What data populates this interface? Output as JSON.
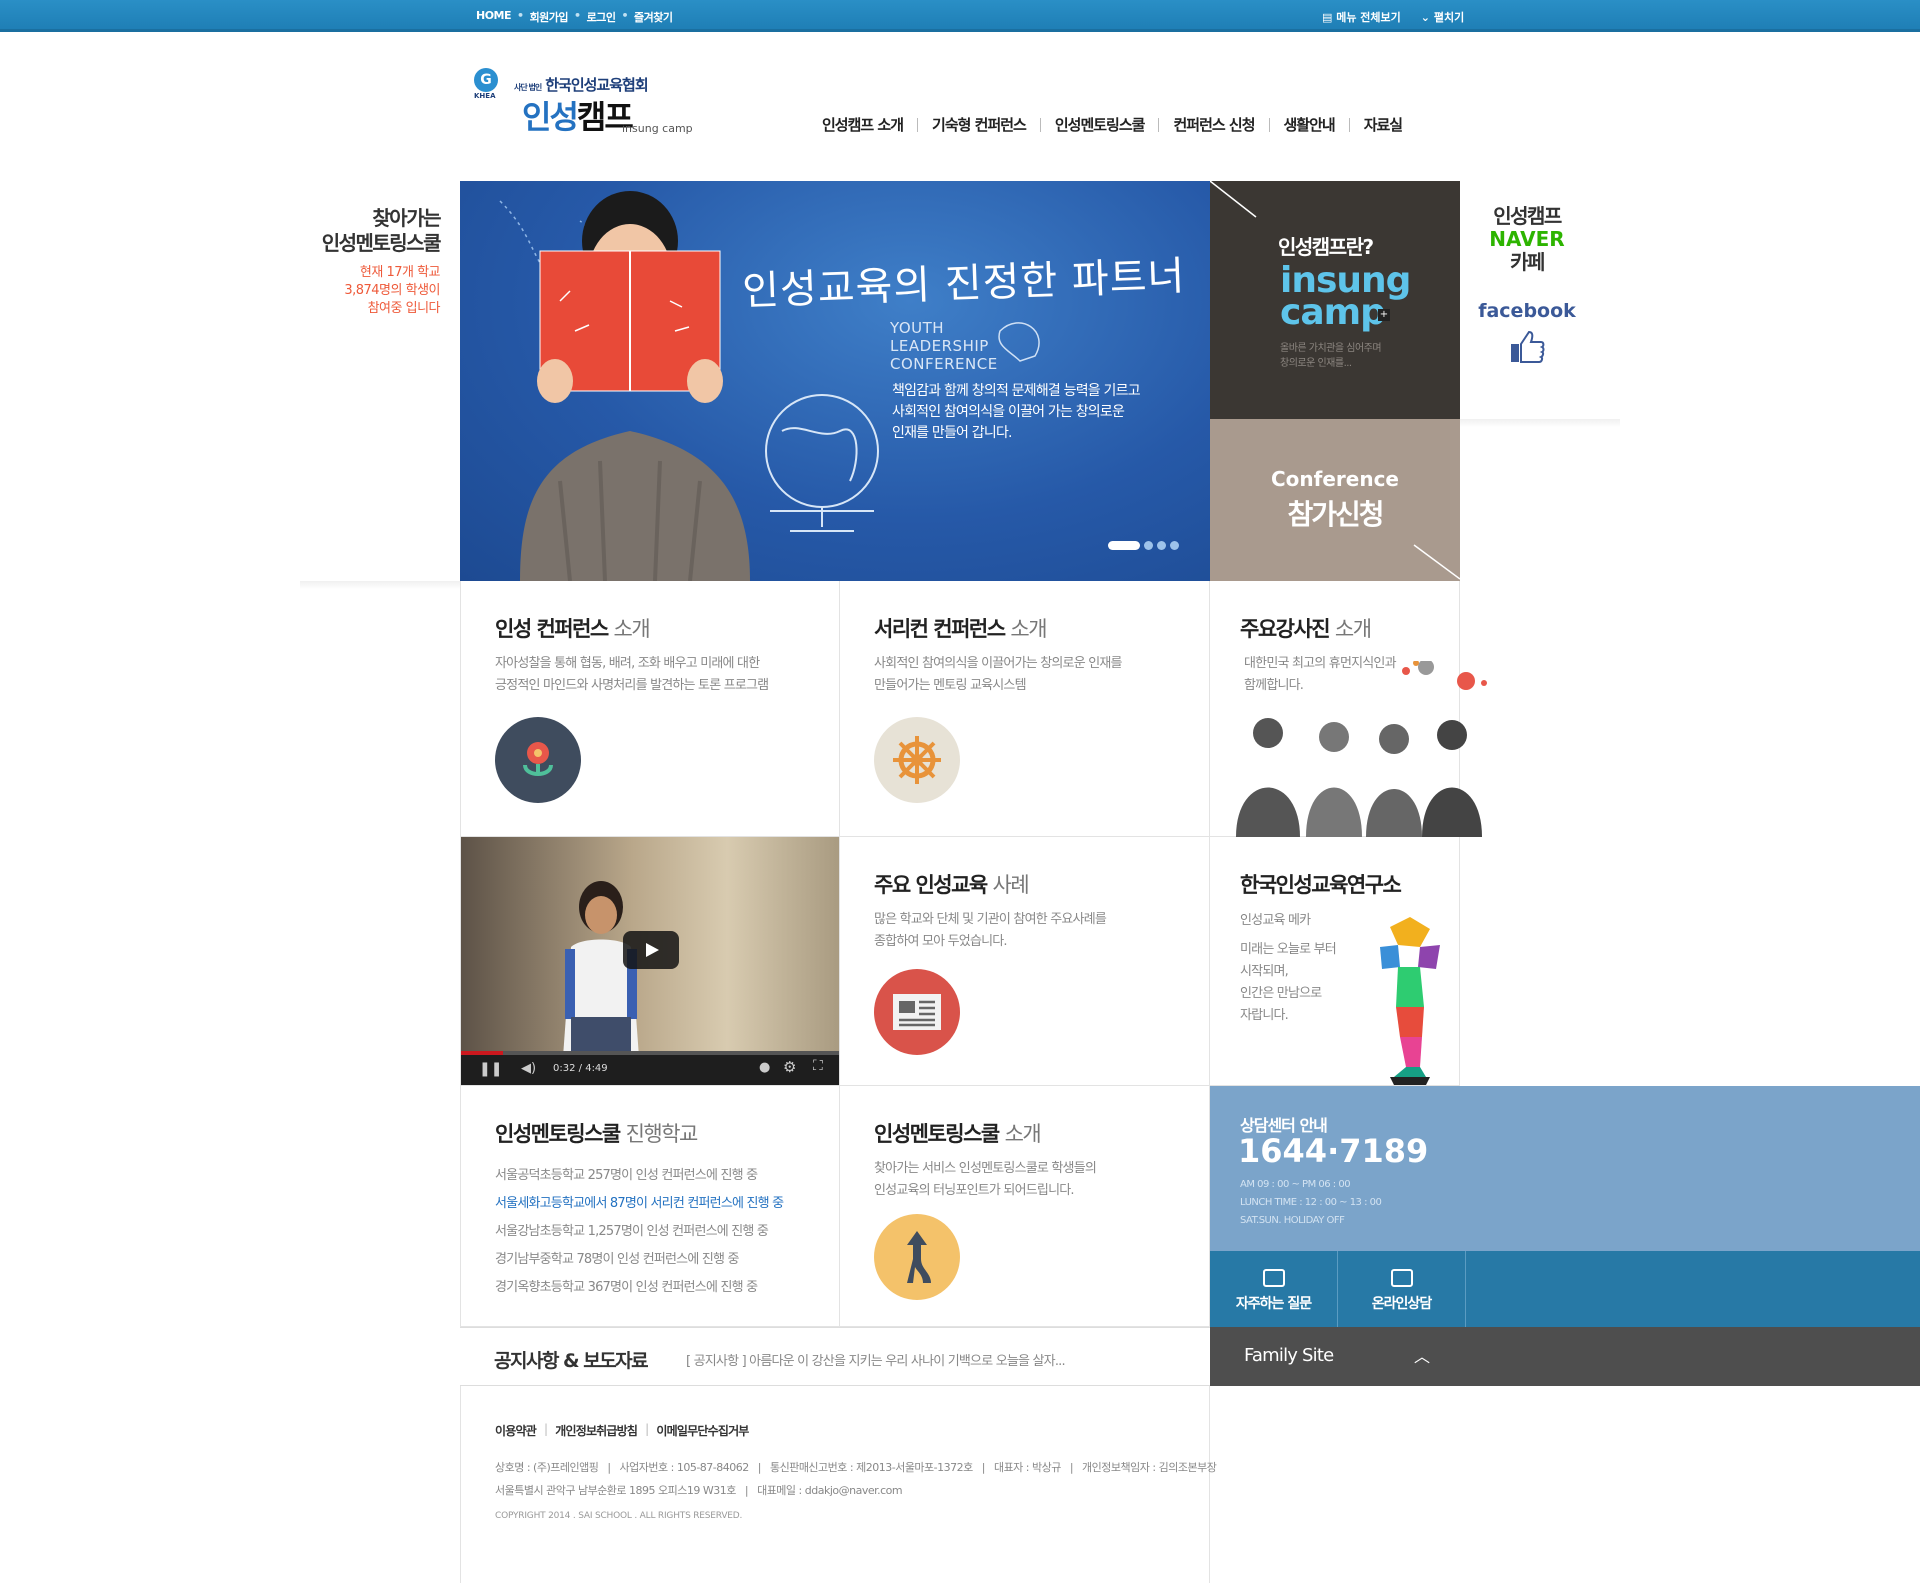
{
  "topbar": {
    "home": "HOME",
    "join": "회원가입",
    "login": "로그인",
    "bookmark": "즐겨찾기",
    "menu_all": "메뉴 전체보기",
    "expand": "펼치기"
  },
  "logo": {
    "badge": "G",
    "badge_text": "KHEA",
    "org_prefix": "사단 법인",
    "org": "한국인성교육협회",
    "brand_a": "인성",
    "brand_b": "캠프",
    "sub": "insung camp"
  },
  "gnb": [
    "인성캠프 소개",
    "기숙형 컨퍼런스",
    "인성멘토링스쿨",
    "컨퍼런스 신청",
    "생활안내",
    "자료실"
  ],
  "left_promo": {
    "title1": "찾아가는",
    "title2": "인성멘토링스쿨",
    "sub1": "현재 17개 학교",
    "sub2": "3,874명의 학생이",
    "sub3": "참여중 입니다"
  },
  "hero": {
    "title": "인성교육의 진정한 파트너",
    "ylc1": "YOUTH",
    "ylc2": "LEADERSHIP",
    "ylc3": "CONFERENCE",
    "desc1": "책임감과 함께 창의적 문제해결 능력을 기르고",
    "desc2": "사회적인 참여의식을 이끌어 가는 창의로운",
    "desc3": "인재를 만들어 갑니다.",
    "slide_count": 4,
    "active_slide": 1
  },
  "panel_camp": {
    "question": "인성캠프란?",
    "logo1": "insung",
    "logo2": "camp",
    "desc1": "올바른 가치관을 심어주며",
    "desc2": "창의로운 인재를..."
  },
  "panel_conf": {
    "en": "Conference",
    "ko": "참가신청"
  },
  "right_promo": {
    "a": "인성캠프",
    "naver": "NAVER",
    "cafe": "카페",
    "facebook": "facebook"
  },
  "cards": {
    "c1": {
      "title": "인성 컨퍼런스",
      "suffix": "소개",
      "desc1": "자아성찰을 통해 협동, 배려, 조화 배우고 미래에 대한",
      "desc2": "긍정적인 마인드와 사명처리를 발견하는 토론 프로그램"
    },
    "c2": {
      "title": "서리컨 컨퍼런스",
      "suffix": "소개",
      "desc1": "사회적인 참여의식을 이끌어가는 창의로운 인재를",
      "desc2": "만들어가는 멘토링 교육시스템"
    },
    "c3": {
      "title": "주요강사진",
      "suffix": "소개",
      "desc1": "대한민국 최고의 휴먼지식인과",
      "desc2": "함께합니다."
    },
    "c4": {
      "title": "주요 인성교육",
      "suffix": "사례",
      "desc1": "많은 학교와 단체 및 기관이 참여한 주요사례를",
      "desc2": "종합하여 모아 두었습니다."
    },
    "c5": {
      "title": "한국인성교육연구소",
      "sub": "인성교육 메카",
      "desc1": "미래는 오늘로 부터",
      "desc2": "시작되며,",
      "desc3": "인간은 만남으로",
      "desc4": "자랍니다."
    },
    "c6": {
      "title": "인성멘토링스쿨",
      "suffix": "진행학교",
      "schools": [
        "서울공덕초등학교 257명이 인성 컨퍼런스에 진행 중",
        "서울세화고등학교에서 87명이 서리컨 컨퍼런스에 진행 중",
        "서울강남초등학교 1,257명이 인성 컨퍼런스에 진행 중",
        "경기남부중학교 78명이 인성 컨퍼런스에 진행 중",
        "경기옥향초등학교 367명이 인성 컨퍼런스에 진행 중"
      ]
    },
    "c7": {
      "title": "인성멘토링스쿨",
      "suffix": "소개",
      "desc1": "찾아가는 서비스 인성멘토링스쿨로 학생들의",
      "desc2": "인성교육의 터닝포인트가 되어드립니다."
    }
  },
  "video": {
    "time": "0:32",
    "duration": "4:49",
    "progress": 0.11
  },
  "counsel": {
    "title": "상담센터 안내",
    "phone": "1644·7189",
    "h1": "AM 09 : 00 ~ PM 06 : 00",
    "h2": "LUNCH TIME : 12 : 00 ~ 13 : 00",
    "h3": "SAT.SUN. HOLIDAY OFF",
    "faq": "자주하는 질문",
    "online": "온라인상담"
  },
  "family": {
    "label": "Family Site"
  },
  "notice": {
    "title": "공지사항 & 보도자료",
    "text": "[ 공지사항 ] 아름다운 이 강산을 지키는 우리 사나이 기백으로 오늘을 살자..."
  },
  "footer": {
    "link1": "이용약관",
    "link2": "개인정보취급방침",
    "link3": "이메일무단수집거부",
    "info1": "상호명 : (주)프레인앱핑   |   사업자번호 : 105-87-84062   |   통신판매신고번호 : 제2013-서울마포-1372호   |   대표자 : 박상규   |   개인정보책임자 : 김의조본부장",
    "info2": "서울특별시 관악구 남부순환로 1895 오피스19 W31호   |   대표메일 : ddakjo@naver.com",
    "copy": "COPYRIGHT 2014 . SAI SCHOOL . ALL RIGHTS RESERVED."
  },
  "colors": {
    "accent": "#2472c1",
    "topbar": "#2a8fc6",
    "counsel": "#7ba4ca",
    "counsel_btns": "#2779a6",
    "family": "#4e4e4e",
    "promo_red": "#ee5a3a"
  }
}
